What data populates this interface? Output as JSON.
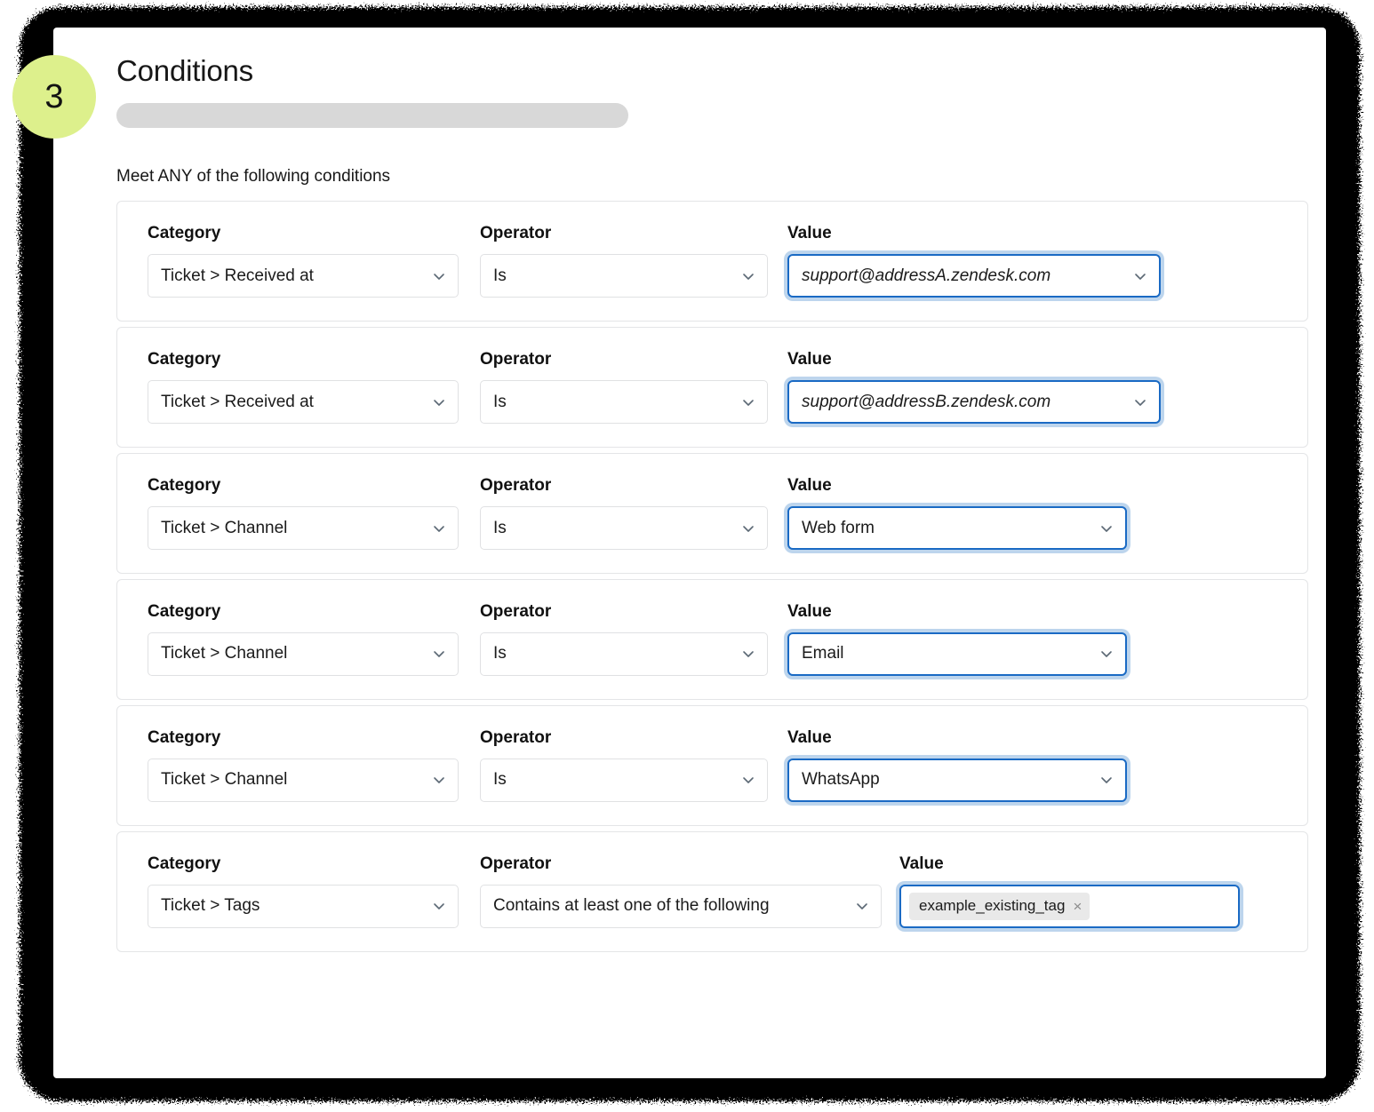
{
  "step": {
    "number": "3",
    "color": "#DDF08C"
  },
  "header": {
    "title": "Conditions",
    "skeleton_bar": true
  },
  "section": {
    "match_label": "Meet ANY of the following conditions"
  },
  "labels": {
    "category": "Category",
    "operator": "Operator",
    "value": "Value"
  },
  "icons": {
    "chevron_down": "chevron-down-icon",
    "tag_remove": "×"
  },
  "colors": {
    "focus_border": "#1A6AC4",
    "focus_ring": "#BDD5ED",
    "card_border": "#E4E5E7",
    "field_border": "#E0E1E3",
    "badge": "#DDF08C",
    "skeleton": "#D8D8D8",
    "chip_bg": "#E9E9E9"
  },
  "conditions": [
    {
      "category": "Ticket > Received at",
      "operator": "Is",
      "value": "support@addressA.zendesk.com",
      "value_italic": true,
      "value_focused": true,
      "value_type": "select"
    },
    {
      "category": "Ticket > Received at",
      "operator": "Is",
      "value": "support@addressB.zendesk.com",
      "value_italic": true,
      "value_focused": true,
      "value_type": "select"
    },
    {
      "category": "Ticket > Channel",
      "operator": "Is",
      "value": "Web form",
      "value_italic": false,
      "value_focused": true,
      "value_type": "select"
    },
    {
      "category": "Ticket > Channel",
      "operator": "Is",
      "value": "Email",
      "value_italic": false,
      "value_focused": true,
      "value_type": "select"
    },
    {
      "category": "Ticket > Channel",
      "operator": "Is",
      "value": "WhatsApp",
      "value_italic": false,
      "value_focused": true,
      "value_type": "select"
    },
    {
      "category": "Ticket > Tags",
      "operator": "Contains at least one of the following",
      "value": "example_existing_tag",
      "value_italic": false,
      "value_focused": true,
      "value_type": "tags"
    }
  ]
}
